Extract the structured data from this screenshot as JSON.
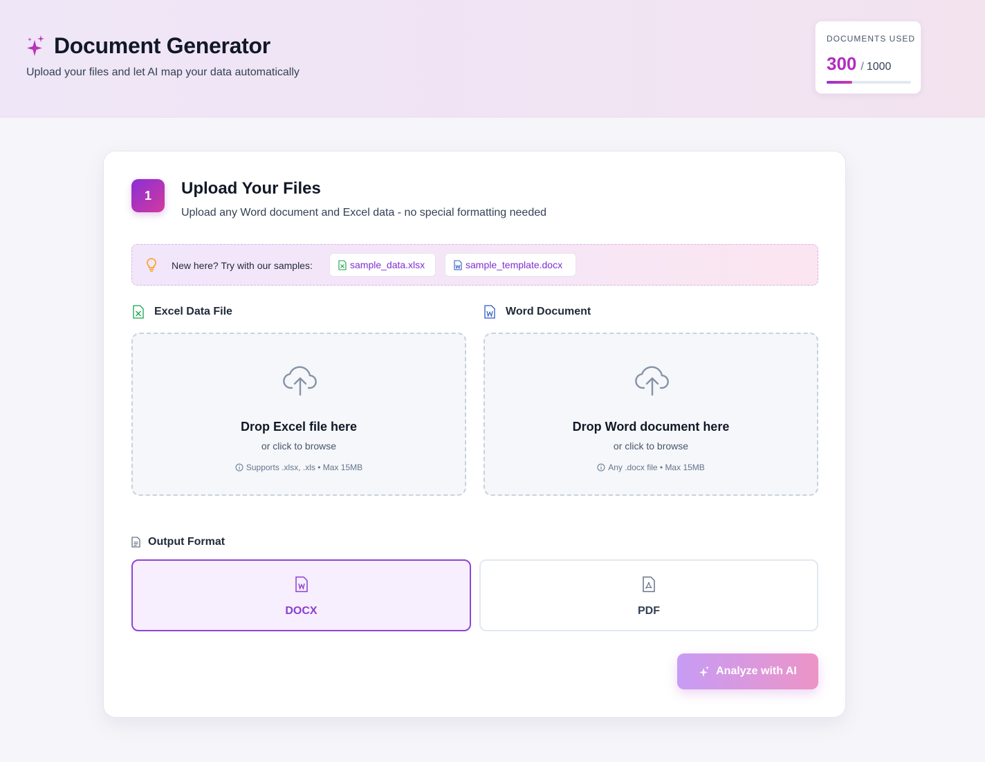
{
  "header": {
    "title": "Document Generator",
    "subtitle": "Upload your files and let AI map your data automatically",
    "icon": "sparkles-icon"
  },
  "usage": {
    "label": "DOCUMENTS USED",
    "used": "300",
    "separator": "/",
    "total": "1000",
    "used_fraction": 0.3
  },
  "step": {
    "number": "1",
    "title": "Upload Your Files",
    "subtitle": "Upload any Word document and Excel data - no special formatting needed"
  },
  "samples": {
    "prompt": "New here? Try with our samples:",
    "excel_sample": "sample_data.xlsx",
    "word_sample": "sample_template.docx"
  },
  "excel_upload": {
    "label": "Excel Data File",
    "title": "Drop Excel file here",
    "sub": "or click to browse",
    "note": "Supports .xlsx, .xls • Max 15MB"
  },
  "word_upload": {
    "label": "Word Document",
    "title": "Drop Word document here",
    "sub": "or click to browse",
    "note": "Any .docx file • Max 15MB"
  },
  "output_format": {
    "label": "Output Format",
    "options": [
      "DOCX",
      "PDF"
    ],
    "selected": "DOCX"
  },
  "analyze": {
    "label": "Analyze with AI"
  },
  "colors": {
    "accent": "#8e44d4",
    "brand_pink": "#d2399e",
    "excel_green": "#16a34a",
    "word_blue": "#2b59c3"
  }
}
